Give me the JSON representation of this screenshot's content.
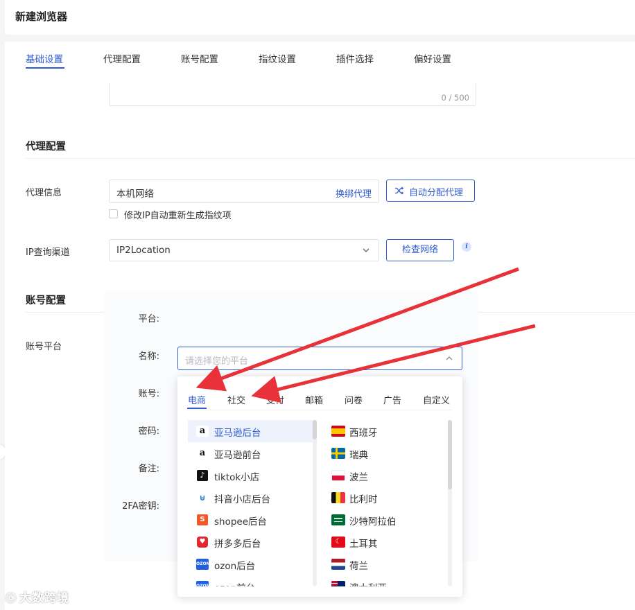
{
  "window": {
    "title": "新建浏览器"
  },
  "tabs": [
    {
      "label": "基础设置",
      "active": true
    },
    {
      "label": "代理配置",
      "active": false
    },
    {
      "label": "账号配置",
      "active": false
    },
    {
      "label": "指纹设置",
      "active": false
    },
    {
      "label": "插件选择",
      "active": false
    },
    {
      "label": "偏好设置",
      "active": false
    }
  ],
  "notes": {
    "counter": "0 / 500"
  },
  "proxy_section": {
    "title": "代理配置",
    "info_label": "代理信息",
    "info_value": "本机网络",
    "rebind_link": "换绑代理",
    "auto_assign_button": "自动分配代理",
    "checkbox_label": "修改IP自动重新生成指纹项",
    "checkbox_checked": false,
    "ip_channel_label": "IP查询渠道",
    "ip_channel_value": "IP2Location",
    "check_network_button": "检查网络"
  },
  "account_section": {
    "title": "账号配置",
    "platform_label": "账号平台",
    "fields": {
      "platform": "平台:",
      "name": "名称:",
      "account": "账号:",
      "password": "密码:",
      "note": "备注:",
      "twofa": "2FA密钥:"
    },
    "platform_placeholder": "请选择您的平台"
  },
  "dropdown": {
    "tabs": [
      {
        "label": "电商",
        "active": true
      },
      {
        "label": "社交",
        "active": false
      },
      {
        "label": "支付",
        "active": false
      },
      {
        "label": "邮箱",
        "active": false
      },
      {
        "label": "问卷",
        "active": false
      },
      {
        "label": "广告",
        "active": false
      },
      {
        "label": "自定义",
        "active": false
      }
    ],
    "platforms": [
      {
        "label": "亚马逊后台",
        "icon": "amazon-icon",
        "selected": true
      },
      {
        "label": "亚马逊前台",
        "icon": "amazon-icon",
        "selected": false
      },
      {
        "label": "tiktok小店",
        "icon": "tiktok-icon",
        "selected": false
      },
      {
        "label": "抖音小店后台",
        "icon": "douyin-shop-icon",
        "selected": false
      },
      {
        "label": "shopee后台",
        "icon": "shopee-icon",
        "selected": false
      },
      {
        "label": "拼多多后台",
        "icon": "pinduoduo-icon",
        "selected": false
      },
      {
        "label": "ozon后台",
        "icon": "ozon-icon",
        "selected": false
      },
      {
        "label": "ozon前台",
        "icon": "ozon-icon",
        "selected": false
      }
    ],
    "regions": [
      {
        "label": "西班牙",
        "icon": "spain-flag-icon"
      },
      {
        "label": "瑞典",
        "icon": "sweden-flag-icon"
      },
      {
        "label": "波兰",
        "icon": "poland-flag-icon"
      },
      {
        "label": "比利时",
        "icon": "belgium-flag-icon"
      },
      {
        "label": "沙特阿拉伯",
        "icon": "saudi-flag-icon"
      },
      {
        "label": "土耳其",
        "icon": "turkey-flag-icon"
      },
      {
        "label": "荷兰",
        "icon": "netherlands-flag-icon"
      },
      {
        "label": "澳大利亚",
        "icon": "australia-flag-icon"
      }
    ]
  },
  "watermark": "大数跨境",
  "colors": {
    "accent": "#2f5bd1",
    "annotation_arrow": "#e8323a"
  }
}
